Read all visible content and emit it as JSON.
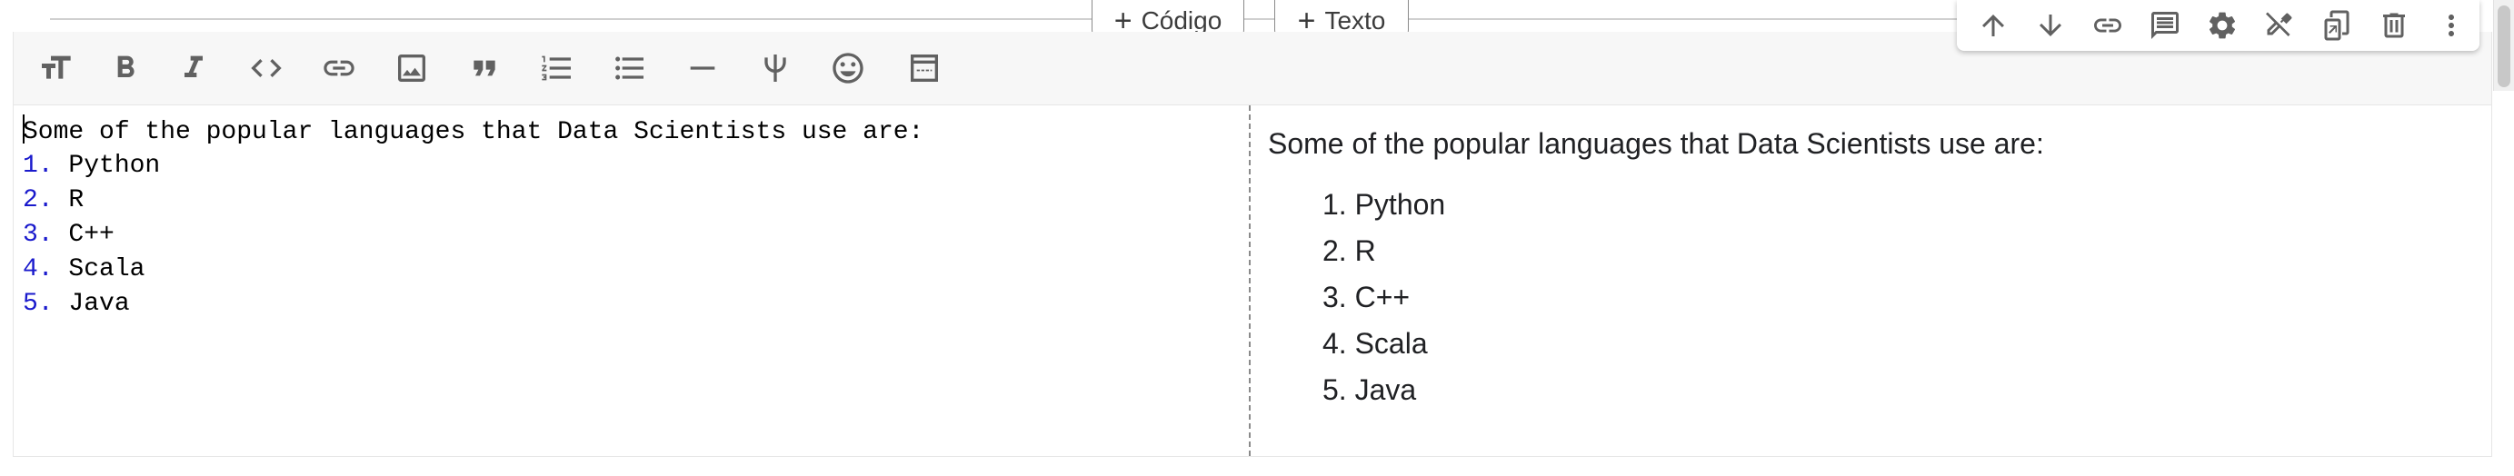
{
  "add_buttons": {
    "code_label": "Código",
    "text_label": "Texto"
  },
  "toolbar": {
    "icons": [
      "text-size-icon",
      "bold-icon",
      "italic-icon",
      "code-icon",
      "link-icon",
      "image-icon",
      "quote-icon",
      "numbered-list-icon",
      "bulleted-list-icon",
      "horizontal-rule-icon",
      "latex-psi-icon",
      "emoji-icon",
      "insert-snippet-icon"
    ]
  },
  "cell_actions": {
    "icons": [
      "move-up-icon",
      "move-down-icon",
      "link-icon",
      "comment-icon",
      "settings-icon",
      "edit-off-icon",
      "mirror-cell-icon",
      "delete-icon",
      "more-icon"
    ]
  },
  "editor": {
    "first_line": "Some of the popular languages that Data Scientists use are:",
    "items": [
      {
        "num": "1.",
        "text": " Python"
      },
      {
        "num": "2.",
        "text": " R"
      },
      {
        "num": "3.",
        "text": " C++"
      },
      {
        "num": "4.",
        "text": " Scala"
      },
      {
        "num": "5.",
        "text": " Java"
      }
    ]
  },
  "preview": {
    "paragraph": "Some of the popular languages that Data Scientists use are:",
    "items": [
      "1. Python",
      "2. R",
      "3. C++",
      "4. Scala",
      "5. Java"
    ]
  }
}
